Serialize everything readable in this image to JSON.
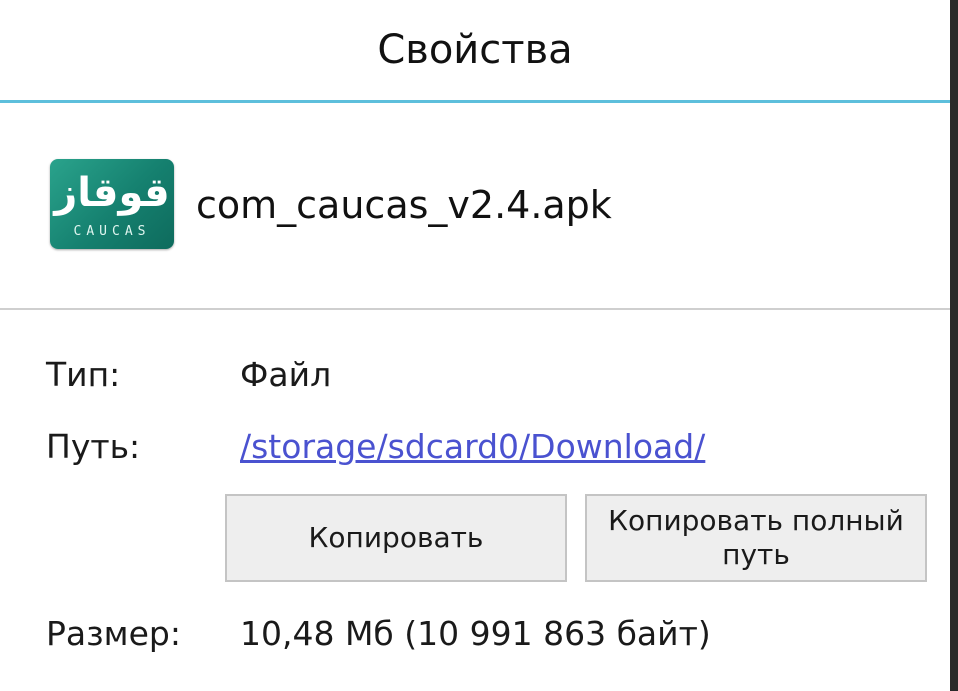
{
  "dialog": {
    "title": "Свойства"
  },
  "file": {
    "name": "com_caucas_v2.4.apk",
    "icon": {
      "semantic": "app-icon-caucas",
      "arabic_text": "قوقاز",
      "latin_text": "CAUCAS",
      "color": "#15806f"
    }
  },
  "properties": {
    "type_label": "Тип:",
    "type_value": "Файл",
    "path_label": "Путь:",
    "path_value": "/storage/sdcard0/Download/",
    "size_label": "Размер:",
    "size_value": "10,48 Мб (10 991 863 байт)"
  },
  "buttons": {
    "copy_label": "Копировать",
    "copy_full_label": "Копировать полный путь"
  },
  "colors": {
    "accent_divider": "#5dbfdc",
    "link": "#4a52d0"
  }
}
